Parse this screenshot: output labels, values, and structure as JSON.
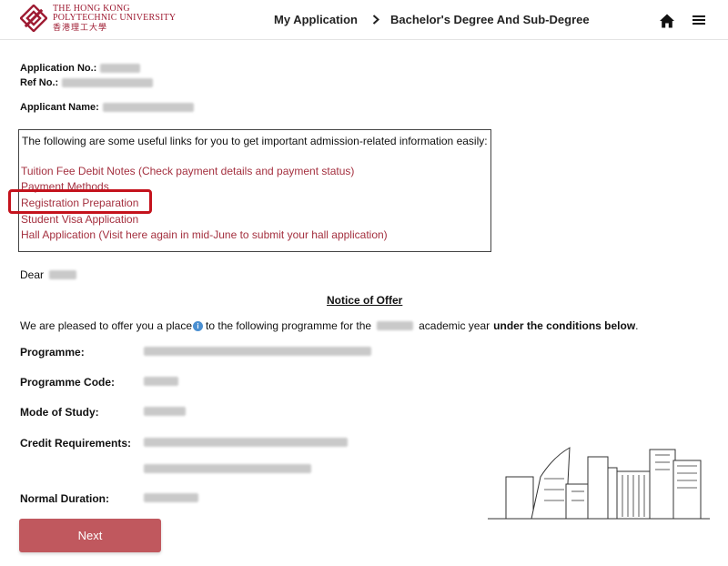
{
  "header": {
    "logo": {
      "line1": "THE HONG KONG",
      "line2": "POLYTECHNIC UNIVERSITY",
      "line3": "香港理工大學"
    },
    "breadcrumb": [
      "My Application",
      "Bachelor's Degree And Sub-Degree"
    ],
    "icons": [
      "home-icon",
      "menu-icon"
    ]
  },
  "applicant": {
    "application_no_label": "Application No.:",
    "ref_no_label": "Ref No.:",
    "name_label": "Applicant Name:"
  },
  "links_box": {
    "intro": "The following are some useful links for you to get important admission-related information easily:",
    "links": [
      "Tuition Fee Debit Notes (Check payment details and payment status)",
      "Payment Methods",
      "Registration Preparation",
      "Student Visa Application",
      "Hall Application (Visit here again in mid-June to submit your hall application)"
    ],
    "highlighted_link": "Registration Preparation",
    "highlight_color": "#c4121c"
  },
  "letter": {
    "salutation": "Dear",
    "notice_title": "Notice of Offer",
    "offer_prefix": "We are pleased to offer you a place",
    "offer_middle": "to the following programme for the",
    "offer_suffix_plain": "academic year",
    "offer_suffix_bold": "under the conditions below",
    "offer_end": "."
  },
  "fields": {
    "programme_label": "Programme:",
    "programme_code_label": "Programme Code:",
    "mode_label": "Mode of Study:",
    "credit_label": "Credit Requirements:",
    "duration_label": "Normal Duration:"
  },
  "actions": {
    "next_label": "Next"
  },
  "colors": {
    "brand": "#9e1b32",
    "link": "#a4303f",
    "button": "#c0585e",
    "info_icon": "#4a8fd1"
  }
}
